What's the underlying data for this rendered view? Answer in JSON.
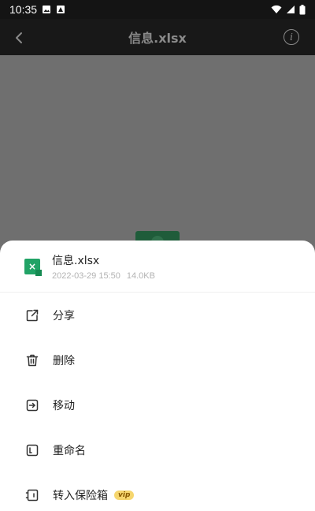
{
  "status_bar": {
    "time": "10:35"
  },
  "app_bar": {
    "title": "信息.xlsx",
    "info_glyph": "i"
  },
  "file": {
    "icon_glyph": "×",
    "name": "信息.xlsx",
    "date": "2022-03-29 15:50",
    "size": "14.0KB"
  },
  "menu": {
    "items": [
      {
        "label": "分享",
        "icon": "share-icon"
      },
      {
        "label": "删除",
        "icon": "trash-icon"
      },
      {
        "label": "移动",
        "icon": "move-icon"
      },
      {
        "label": "重命名",
        "icon": "rename-icon"
      },
      {
        "label": "转入保险箱",
        "icon": "safe-icon",
        "badge": "vip"
      }
    ]
  },
  "colors": {
    "xlsx_green": "#21a366",
    "vip_gold": "#f6d66e",
    "overlay_grey": "#6f6f6f"
  }
}
